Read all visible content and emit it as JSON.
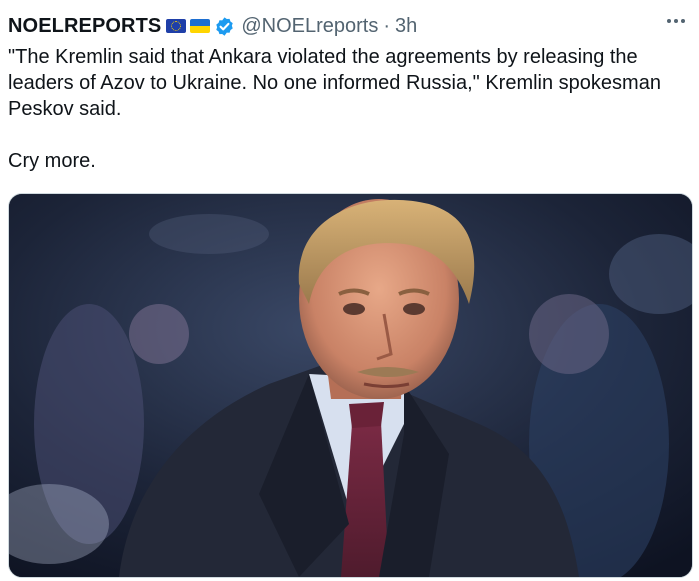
{
  "tweet": {
    "author": {
      "display_name": "NOELREPORTS",
      "badges": [
        "eu-flag-icon",
        "ukraine-flag-icon"
      ],
      "verified": true,
      "handle": "@NOELreports",
      "separator": "·",
      "timestamp": "3h"
    },
    "text": "\"The Kremlin said that Ankara violated the agreements by releasing the\nleaders of Azov to Ukraine. No one informed Russia,\" Kremlin spokesman\nPeskov said.\n\nCry more.",
    "more_icon": "more-horizontal-icon",
    "media": {
      "type": "photo"
    }
  },
  "colors": {
    "text": "#0f1419",
    "secondary": "#536471",
    "verified": "#1d9bf0"
  }
}
